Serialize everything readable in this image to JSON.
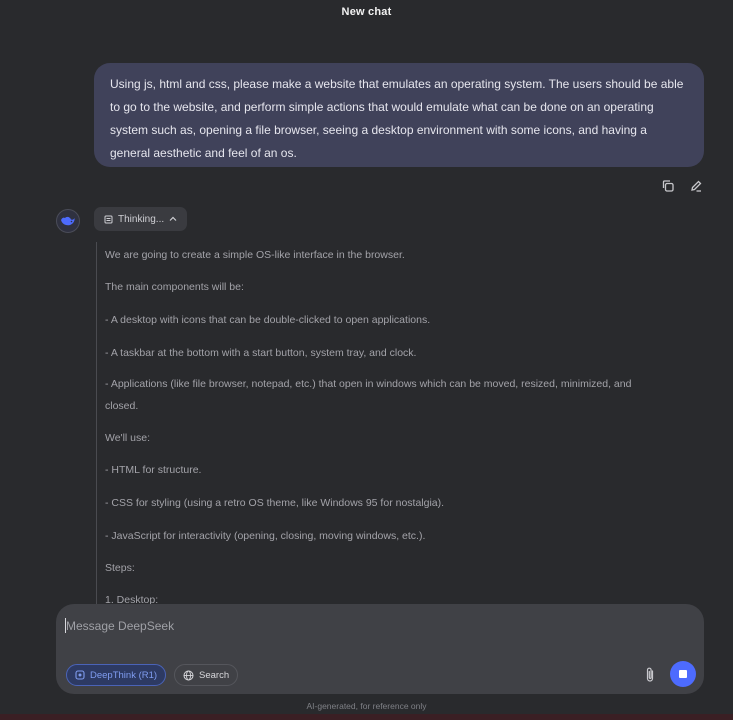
{
  "header": {
    "title": "New chat"
  },
  "user_message": {
    "text": "Using js, html and css, please make a website that emulates an operating system. The users should be able to go to the website, and perform simple actions that would emulate what can be done on an operating system such as, opening a file browser, seeing a desktop environment with some icons, and having a general aesthetic and feel of an os."
  },
  "message_actions": {
    "copy_icon": "copy-icon",
    "edit_icon": "edit-icon"
  },
  "assistant": {
    "avatar_icon": "deepseek-whale-icon",
    "thinking_label": "Thinking...",
    "thinking_lines": [
      "We are going to create a simple OS-like interface in the browser.",
      "The main components will be:",
      "- A desktop with icons that can be double-clicked to open applications.",
      "- A taskbar at the bottom with a start button, system tray, and clock.",
      "- Applications (like file browser, notepad, etc.) that open in windows which can be moved, resized, minimized, and",
      "closed.",
      "We'll use:",
      "- HTML for structure.",
      "- CSS for styling (using a retro OS theme, like Windows 95 for nostalgia).",
      "- JavaScript for interactivity (opening, closing, moving windows, etc.).",
      "Steps:",
      "1. Desktop:"
    ]
  },
  "composer": {
    "placeholder": "Message DeepSeek",
    "deepthink_label": "DeepThink (R1)",
    "search_label": "Search",
    "accent": "#4d6bfe"
  },
  "footer": {
    "note": "AI-generated, for reference only"
  }
}
